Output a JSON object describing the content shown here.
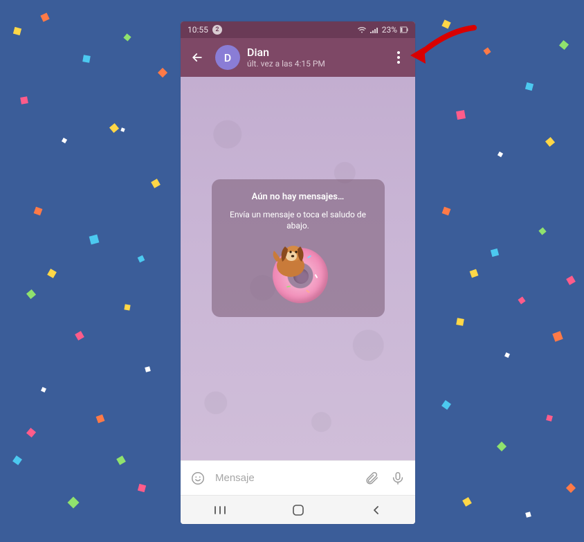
{
  "status_bar": {
    "time": "10:55",
    "notif_count": "2",
    "battery_text": "23%"
  },
  "header": {
    "avatar_initial": "D",
    "contact_name": "Dian",
    "contact_status": "últ. vez a las 4:15 PM"
  },
  "empty_state": {
    "title": "Aún no hay mensajes…",
    "subtitle": "Envía un mensaje o toca el saludo de abajo."
  },
  "input": {
    "placeholder": "Mensaje"
  },
  "colors": {
    "header_bg": "#7e4866",
    "status_bg": "#6a3a56",
    "avatar_bg": "#8a7dd6",
    "arrow": "#d90000"
  }
}
